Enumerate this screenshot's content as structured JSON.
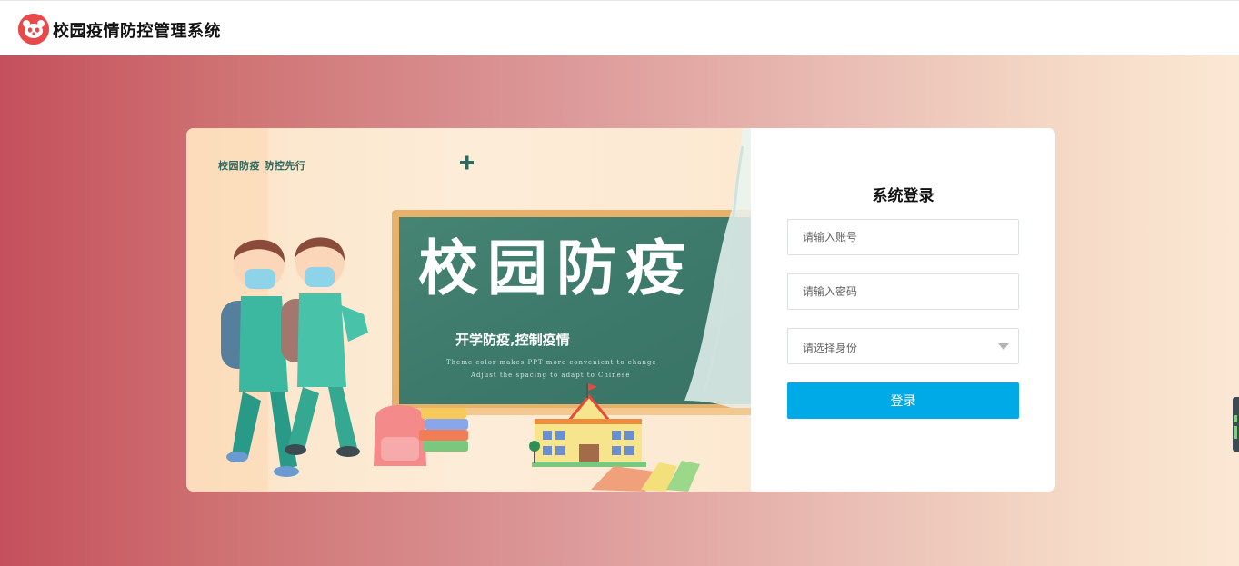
{
  "header": {
    "app_title": "校园疫情防控管理系统",
    "logo_icon": "red-panda-logo-icon"
  },
  "banner": {
    "slogan": "校园防疫  防控先行",
    "board_title": "校园防疫",
    "board_subtitle": "开学防疫,控制疫情",
    "board_english_line1": "Theme color makes PPT more convenient to change",
    "board_english_line2": "Adjust the spacing to adapt to Chinese"
  },
  "login": {
    "title": "系统登录",
    "account_placeholder": "请输入账号",
    "password_placeholder": "请输入密码",
    "role_placeholder": "请选择身份",
    "submit_label": "登录"
  },
  "colors": {
    "accent": "#00aae6",
    "brand": "#e84a4a",
    "board": "#3f7a6c"
  }
}
